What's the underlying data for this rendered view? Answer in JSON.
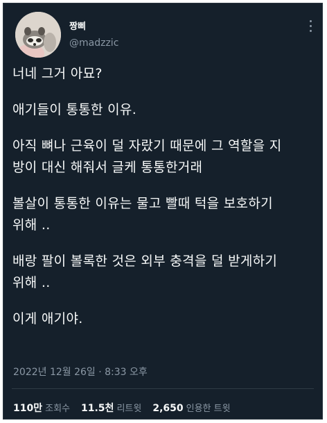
{
  "tweet": {
    "author": {
      "name": "짱삐",
      "handle": "@madzzic"
    },
    "paragraphs": [
      "너네 그거 아묘?",
      "애기들이 통통한 이유.",
      "아직 뼈나 근육이 덜 자랐기 때문에 그 역할을 지\n방이 대신 해줘서 글케 통통한거래",
      "볼살이 통통한 이유는 물고 빨때 턱을 보호하기\n위해 ..",
      "배랑 팔이 볼록한 것은 외부 충격을 덜 받게하기\n위해 ..",
      "이게 애기야."
    ],
    "timestamp": "2022년 12월 26일 · 8:33 오후",
    "stats": [
      {
        "value": "110만",
        "label": "조회수"
      },
      {
        "value": "11.5천",
        "label": "리트윗"
      },
      {
        "value": "2,650",
        "label": "인용한 트윗"
      }
    ]
  },
  "colors": {
    "background": "#15202b",
    "text": "#f7f9f9",
    "secondary": "#8b98a5"
  },
  "icons": {
    "more": "more-vertical-icon",
    "avatar": "raccoon-avatar"
  }
}
